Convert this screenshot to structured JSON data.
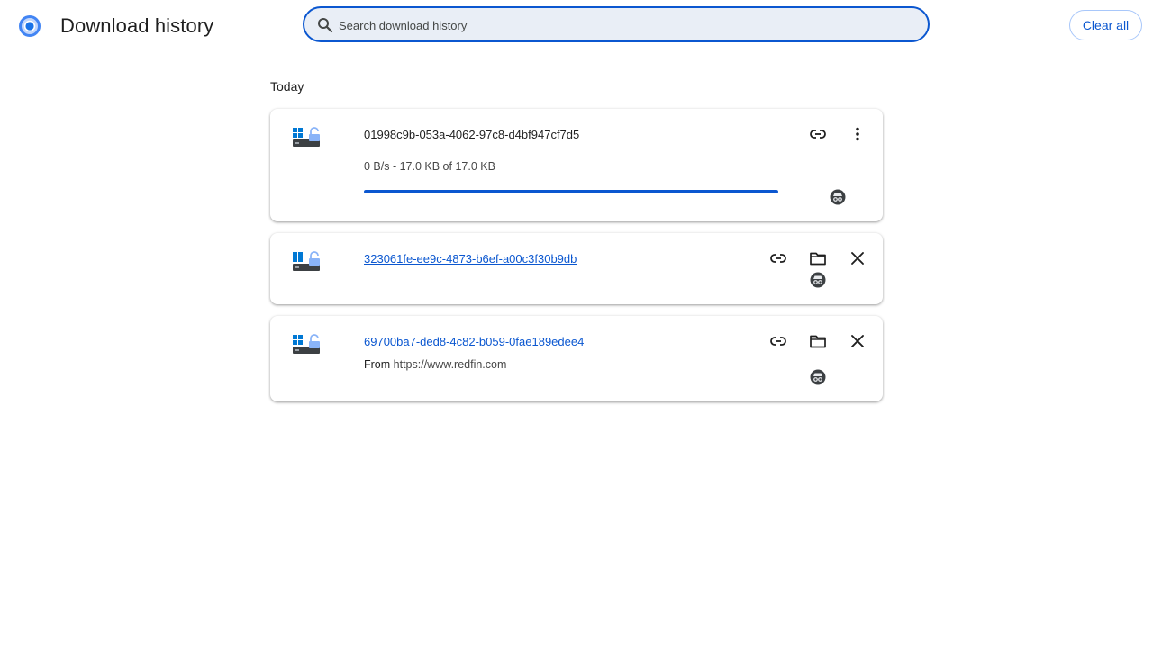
{
  "header": {
    "title": "Download history",
    "search_placeholder": "Search download history",
    "search_value": "",
    "clear_all_label": "Clear all"
  },
  "section": {
    "label": "Today"
  },
  "downloads": [
    {
      "name": "01998c9b-053a-4062-97c8-d4bf947cf7d5",
      "status": "0 B/s - 17.0 KB of 17.0 KB",
      "progress": 1.0,
      "in_progress": true
    },
    {
      "name": "323061fe-ee9c-4873-b6ef-a00c3f30b9db",
      "in_progress": false
    },
    {
      "name": "69700ba7-ded8-4c82-b059-0fae189edee4",
      "from_label": "From",
      "from_url": "https://www.redfin.com",
      "in_progress": false
    }
  ],
  "colors": {
    "accent": "#0b57d0",
    "search_bg": "#e9eef6",
    "progress_track": "#d3e3fd"
  },
  "icons": {
    "app": "chrome-logo-icon",
    "search": "search-icon",
    "file": "file-type-icon",
    "copy_link": "link-icon",
    "more": "more-vert-icon",
    "folder": "folder-icon",
    "remove": "close-icon",
    "incognito": "incognito-icon"
  }
}
